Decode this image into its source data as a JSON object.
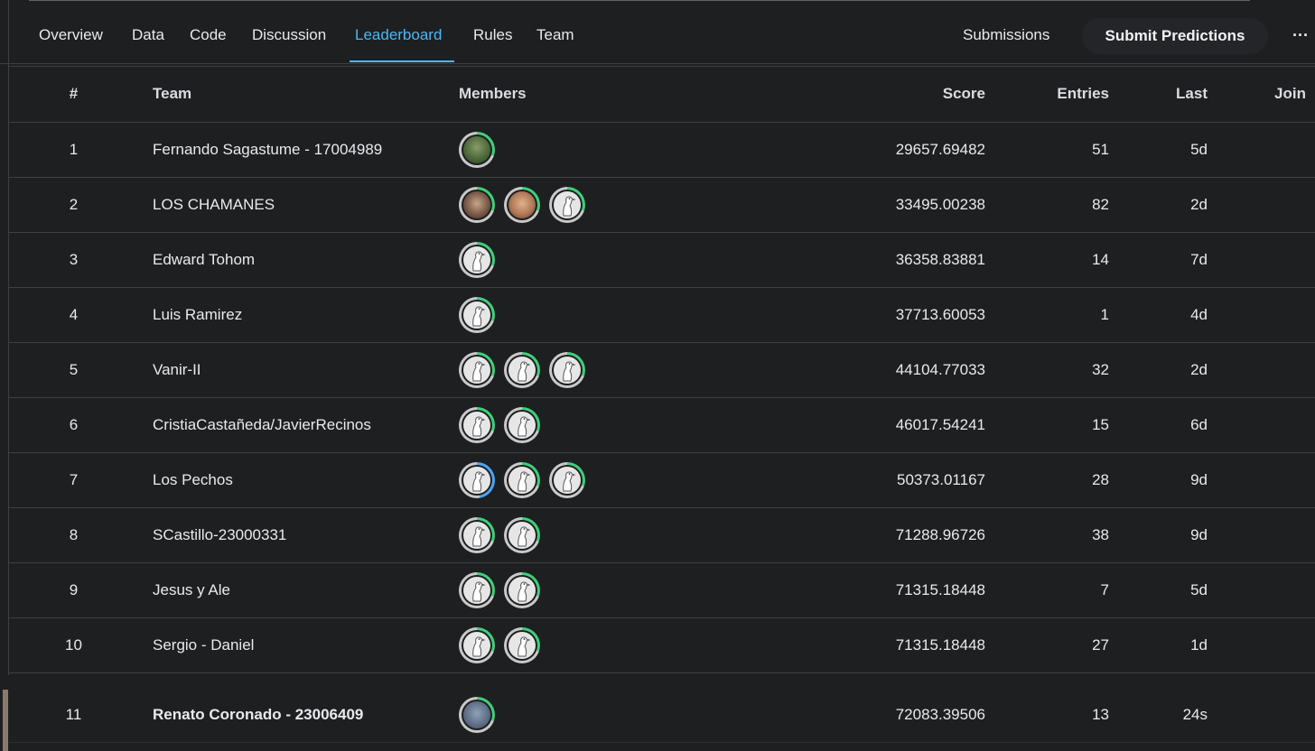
{
  "nav": {
    "tabs": [
      {
        "label": "Overview"
      },
      {
        "label": "Data"
      },
      {
        "label": "Code"
      },
      {
        "label": "Discussion"
      },
      {
        "label": "Leaderboard",
        "active": true
      },
      {
        "label": "Rules"
      },
      {
        "label": "Team"
      }
    ],
    "submissions_label": "Submissions",
    "submit_label": "Submit Predictions",
    "more_label": "···"
  },
  "table": {
    "headers": {
      "rank": "#",
      "team": "Team",
      "members": "Members",
      "score": "Score",
      "entries": "Entries",
      "last": "Last",
      "join": "Join"
    },
    "rows": [
      {
        "rank": "1",
        "team": "Fernando Sagastume - 17004989",
        "members": [
          "photo-a"
        ],
        "score": "29657.69482",
        "entries": "51",
        "last": "5d"
      },
      {
        "rank": "2",
        "team": "LOS CHAMANES",
        "members": [
          "photo-b",
          "photo-c",
          "default"
        ],
        "score": "33495.00238",
        "entries": "82",
        "last": "2d"
      },
      {
        "rank": "3",
        "team": "Edward Tohom",
        "members": [
          "default"
        ],
        "score": "36358.83881",
        "entries": "14",
        "last": "7d"
      },
      {
        "rank": "4",
        "team": "Luis Ramirez",
        "members": [
          "default"
        ],
        "score": "37713.60053",
        "entries": "1",
        "last": "4d"
      },
      {
        "rank": "5",
        "team": "Vanir-II",
        "members": [
          "default",
          "default",
          "default"
        ],
        "score": "44104.77033",
        "entries": "32",
        "last": "2d"
      },
      {
        "rank": "6",
        "team": "CristiaCastañeda/JavierRecinos",
        "members": [
          "default",
          "default"
        ],
        "score": "46017.54241",
        "entries": "15",
        "last": "6d"
      },
      {
        "rank": "7",
        "team": "Los Pechos",
        "members": [
          "default-blue",
          "default",
          "default"
        ],
        "score": "50373.01167",
        "entries": "28",
        "last": "9d"
      },
      {
        "rank": "8",
        "team": "SCastillo-23000331",
        "members": [
          "default",
          "default"
        ],
        "score": "71288.96726",
        "entries": "38",
        "last": "9d"
      },
      {
        "rank": "9",
        "team": "Jesus y Ale",
        "members": [
          "default",
          "default"
        ],
        "score": "71315.18448",
        "entries": "7",
        "last": "5d"
      },
      {
        "rank": "10",
        "team": "Sergio - Daniel",
        "members": [
          "default",
          "default"
        ],
        "score": "71315.18448",
        "entries": "27",
        "last": "1d"
      }
    ],
    "your_row": {
      "rank": "11",
      "team": "Renato Coronado - 23006409",
      "members": [
        "photo-d"
      ],
      "score": "72083.39506",
      "entries": "13",
      "last": "24s"
    }
  },
  "colors": {
    "accent": "#4cb7f5",
    "background": "#1e1f21",
    "progress_green": "#3ed07a",
    "progress_blue": "#4ca3f5"
  },
  "icons": {
    "default_avatar": "goose-avatar-icon",
    "more": "more-horizontal-icon"
  }
}
